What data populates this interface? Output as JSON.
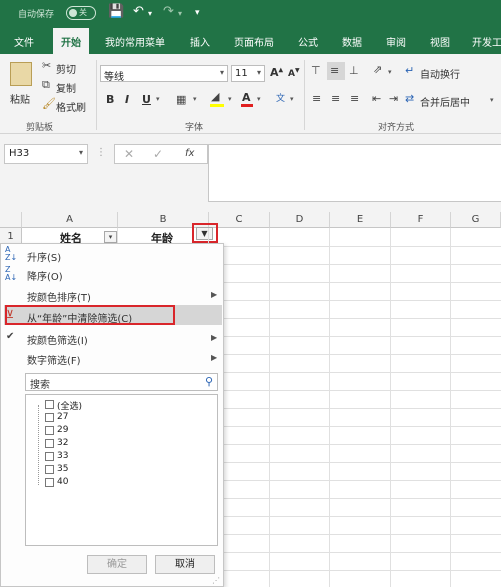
{
  "titlebar": {
    "autosave": "自动保存",
    "toggle": "关"
  },
  "tabs": [
    "文件",
    "开始",
    "我的常用菜单",
    "插入",
    "页面布局",
    "公式",
    "数据",
    "审阅",
    "视图",
    "开发工"
  ],
  "ribbon": {
    "paste": "粘贴",
    "cut": "剪切",
    "copy": "复制",
    "format_painter": "格式刷",
    "clipboard_group": "剪贴板",
    "font_name": "等线",
    "font_size": "11",
    "font_group": "字体",
    "wrap_text": "自动换行",
    "merge_center": "合并后居中",
    "align_group": "对齐方式"
  },
  "formula_bar": {
    "name_box": "H33",
    "fx": "fx"
  },
  "columns": [
    "A",
    "B",
    "C",
    "D",
    "E",
    "F",
    "G"
  ],
  "rows": [
    "1"
  ],
  "cells": {
    "A1": "姓名",
    "B1": "年龄"
  },
  "filter_menu": {
    "sort_asc": "升序(S)",
    "sort_desc": "降序(O)",
    "sort_by_color": "按颜色排序(T)",
    "clear_filter": "从“年龄”中清除筛选(C)",
    "filter_by_color": "按颜色筛选(I)",
    "number_filter": "数字筛选(F)",
    "search_placeholder": "搜索",
    "values": [
      "(全选)",
      "27",
      "29",
      "32",
      "33",
      "35",
      "40"
    ],
    "ok": "确定",
    "cancel": "取消"
  },
  "colors": {
    "accent": "#217346",
    "highlight": "#d9262b"
  }
}
